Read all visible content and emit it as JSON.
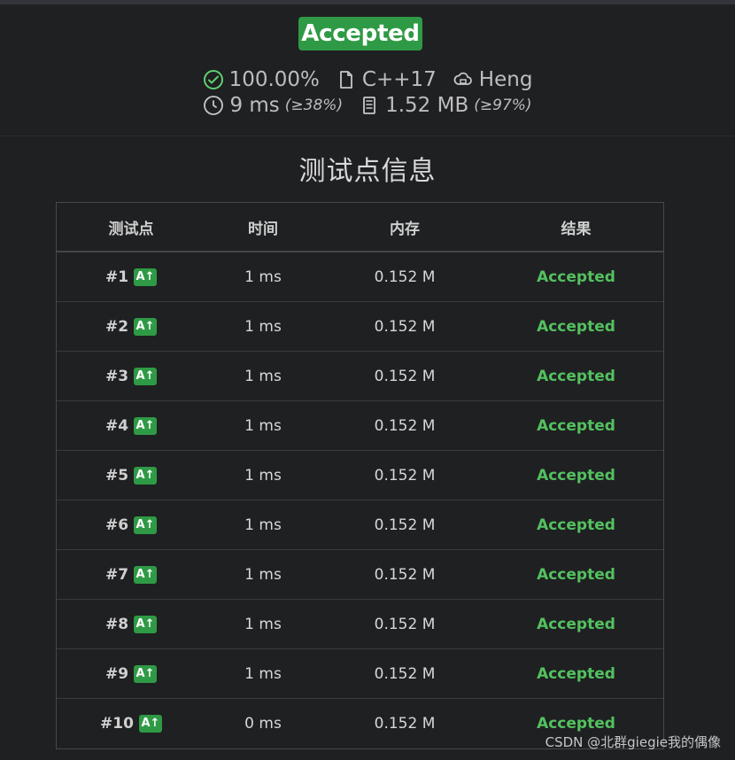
{
  "status": {
    "badge": "Accepted",
    "score": "100.00%",
    "language": "C++17",
    "judge": "Heng",
    "time": "9 ms",
    "time_note": "(≥38%)",
    "memory": "1.52 MB",
    "memory_note": "(≥97%)"
  },
  "section": {
    "title": "测试点信息"
  },
  "table": {
    "headers": [
      "测试点",
      "时间",
      "内存",
      "结果"
    ],
    "rows": [
      {
        "id": "#1",
        "badge": "A↑",
        "time": "1 ms",
        "memory": "0.152 M",
        "result": "Accepted"
      },
      {
        "id": "#2",
        "badge": "A↑",
        "time": "1 ms",
        "memory": "0.152 M",
        "result": "Accepted"
      },
      {
        "id": "#3",
        "badge": "A↑",
        "time": "1 ms",
        "memory": "0.152 M",
        "result": "Accepted"
      },
      {
        "id": "#4",
        "badge": "A↑",
        "time": "1 ms",
        "memory": "0.152 M",
        "result": "Accepted"
      },
      {
        "id": "#5",
        "badge": "A↑",
        "time": "1 ms",
        "memory": "0.152 M",
        "result": "Accepted"
      },
      {
        "id": "#6",
        "badge": "A↑",
        "time": "1 ms",
        "memory": "0.152 M",
        "result": "Accepted"
      },
      {
        "id": "#7",
        "badge": "A↑",
        "time": "1 ms",
        "memory": "0.152 M",
        "result": "Accepted"
      },
      {
        "id": "#8",
        "badge": "A↑",
        "time": "1 ms",
        "memory": "0.152 M",
        "result": "Accepted"
      },
      {
        "id": "#9",
        "badge": "A↑",
        "time": "1 ms",
        "memory": "0.152 M",
        "result": "Accepted"
      },
      {
        "id": "#10",
        "badge": "A↑",
        "time": "0 ms",
        "memory": "0.152 M",
        "result": "Accepted"
      }
    ]
  },
  "watermark": "CSDN @北群giegie我的偶像",
  "colors": {
    "background": "#1f2022",
    "accent": "#2f9a45",
    "result_green": "#53c15f",
    "text": "#d7d7d7"
  }
}
